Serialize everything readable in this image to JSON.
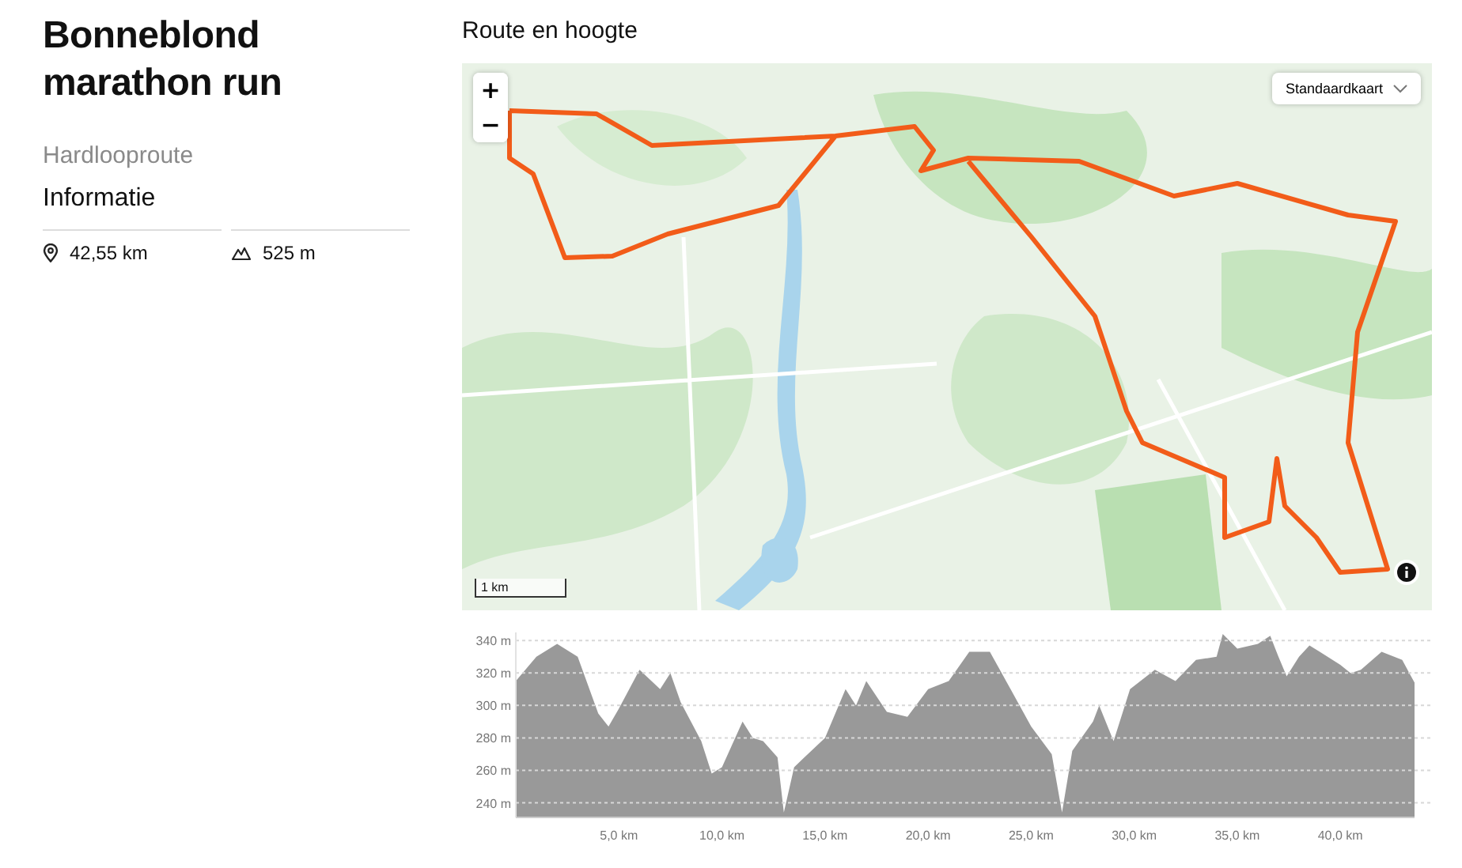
{
  "title": "Bonneblond marathon run",
  "subtitle": "Hardlooproute",
  "info": {
    "heading": "Informatie",
    "stats": [
      {
        "kind": "distance",
        "value": "42,55 km"
      },
      {
        "kind": "ascent",
        "value": "525 m"
      }
    ]
  },
  "section_title": "Route en hoogte",
  "map": {
    "zoom_in": "+",
    "zoom_out": "−",
    "layer_select": "Standaardkaart",
    "scale": "1 km"
  },
  "elevation": {
    "chart_data": {
      "type": "area",
      "x": [
        0,
        1,
        2,
        3,
        4,
        4.5,
        5,
        6,
        7,
        7.5,
        8,
        9,
        9.5,
        10,
        11,
        11.5,
        12,
        12.7,
        13,
        13.5,
        14,
        15,
        16,
        16.5,
        17,
        18,
        19,
        20,
        21,
        22,
        23,
        24,
        25,
        26,
        26.5,
        27,
        28,
        28.3,
        29,
        29.8,
        31,
        32,
        33,
        34,
        34.3,
        35,
        36,
        36.6,
        37,
        37.4,
        38,
        38.5,
        39,
        40,
        40.5,
        41,
        42,
        43,
        43.6
      ],
      "series": [
        {
          "color": "#999999",
          "values": [
            315,
            330,
            338,
            330,
            295,
            287,
            298,
            322,
            310,
            320,
            302,
            278,
            258,
            262,
            290,
            280,
            278,
            268,
            234,
            262,
            268,
            280,
            310,
            300,
            315,
            296,
            293,
            310,
            315,
            333,
            333,
            310,
            287,
            270,
            234,
            272,
            290,
            300,
            278,
            310,
            322,
            315,
            328,
            330,
            344,
            335,
            338,
            343,
            330,
            318,
            330,
            337,
            333,
            325,
            320,
            322,
            333,
            328,
            314
          ]
        }
      ],
      "xlim": [
        0,
        43.6
      ],
      "ylim": [
        231,
        345
      ],
      "grid": true,
      "xticks": [
        {
          "value": 5,
          "label": "5,0 km"
        },
        {
          "value": 10,
          "label": "10,0 km"
        },
        {
          "value": 15,
          "label": "15,0 km"
        },
        {
          "value": 20,
          "label": "20,0 km"
        },
        {
          "value": 25,
          "label": "25,0 km"
        },
        {
          "value": 30,
          "label": "30,0 km"
        },
        {
          "value": 35,
          "label": "35,0 km"
        },
        {
          "value": 40,
          "label": "40,0 km"
        }
      ],
      "yticks": [
        {
          "value": 240,
          "label": "240 m"
        },
        {
          "value": 260,
          "label": "260 m"
        },
        {
          "value": 280,
          "label": "280 m"
        },
        {
          "value": 300,
          "label": "300 m"
        },
        {
          "value": 320,
          "label": "320 m"
        },
        {
          "value": 340,
          "label": "340 m"
        }
      ]
    }
  }
}
